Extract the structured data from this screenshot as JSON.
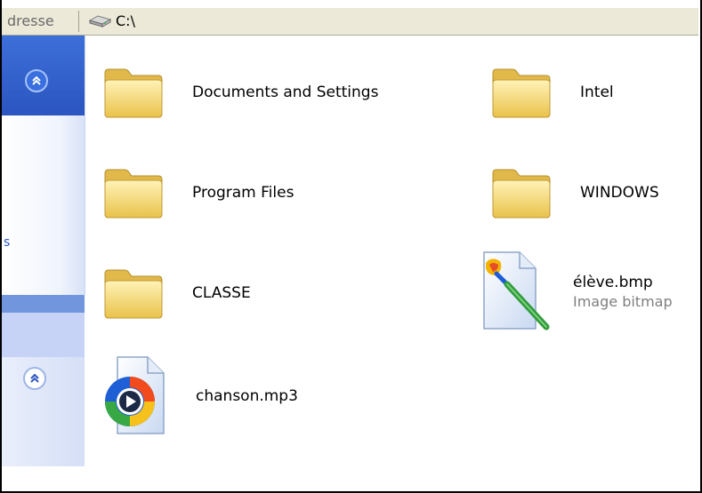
{
  "title_fragment": "...",
  "address": {
    "label": "dresse",
    "value": "C:\\",
    "icon": "drive-icon"
  },
  "taskpane": {
    "stub_text": "s",
    "collapse_icon": "double-chevron-up-icon"
  },
  "files": [
    {
      "name": "Documents and Settings",
      "icon": "folder-icon"
    },
    {
      "name": "Intel",
      "icon": "folder-icon"
    },
    {
      "name": "Program Files",
      "icon": "folder-icon"
    },
    {
      "name": "WINDOWS",
      "icon": "folder-icon"
    },
    {
      "name": "CLASSE",
      "icon": "folder-icon"
    },
    {
      "name": "élève.bmp",
      "type": "Image bitmap",
      "icon": "paint-bitmap-icon"
    },
    {
      "name": "chanson.mp3",
      "icon": "media-player-icon"
    }
  ],
  "colors": {
    "folder": "#f2d56a",
    "taskpane_blue": "#2b55c0",
    "address_bg": "#ece9d8"
  }
}
